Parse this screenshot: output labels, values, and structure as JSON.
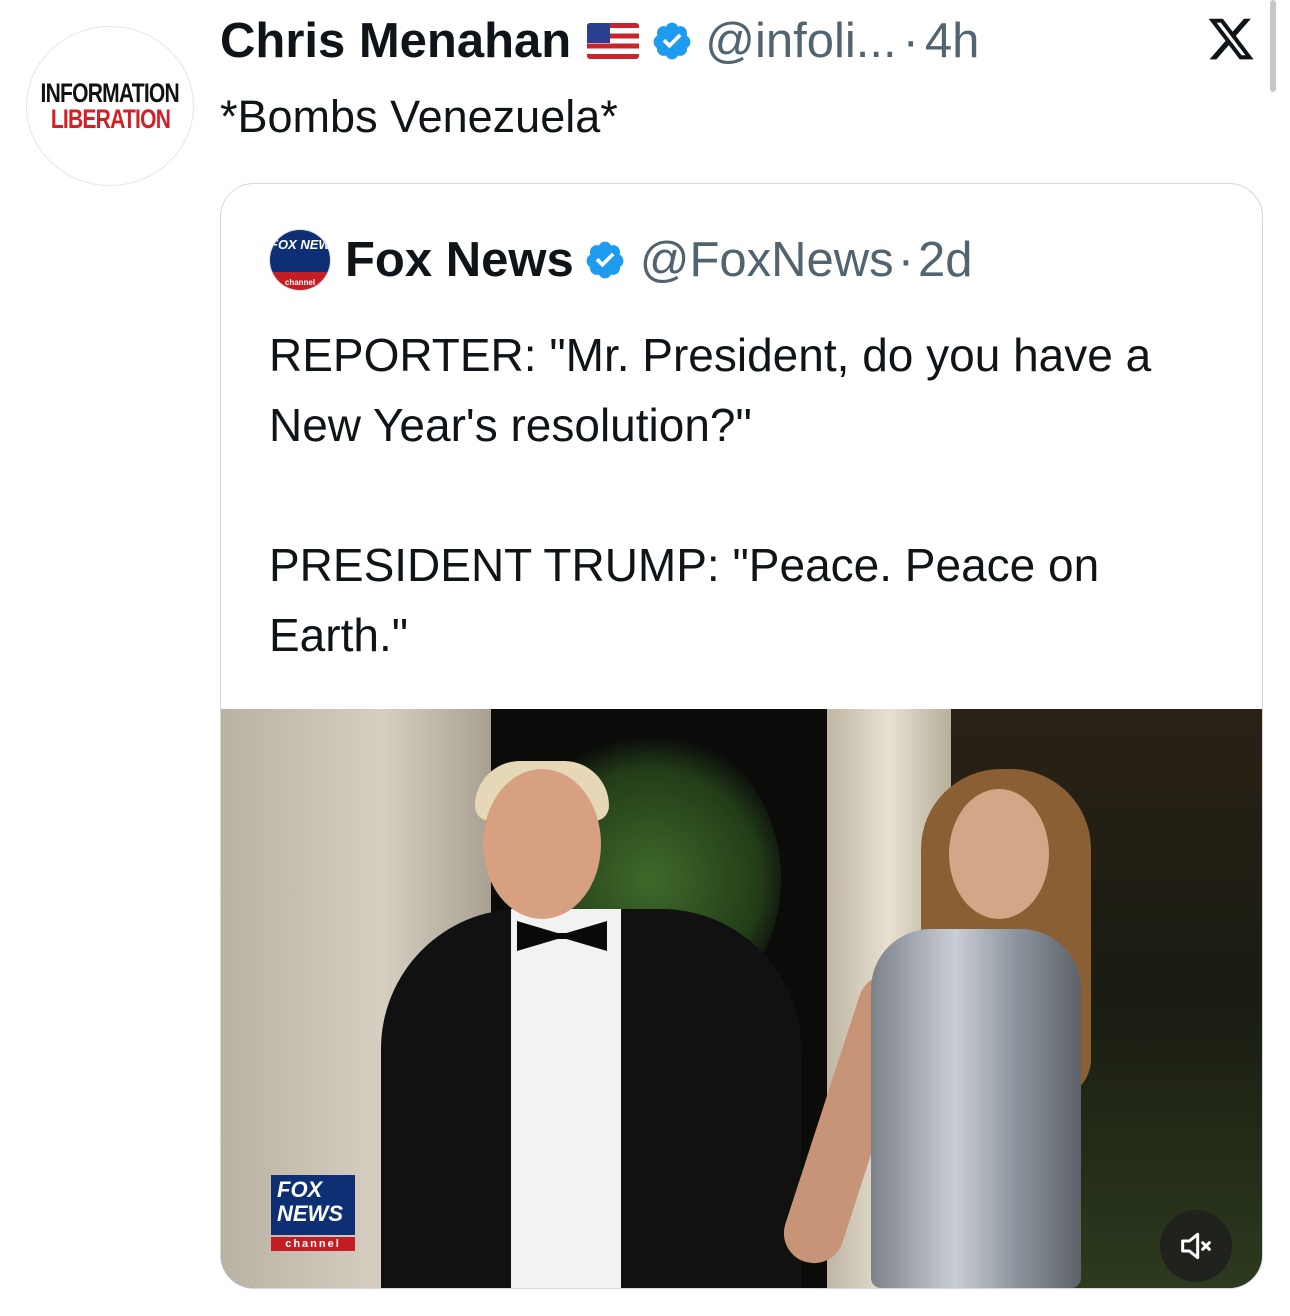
{
  "tweet": {
    "author": {
      "avatar_line1": "INFORMATION",
      "avatar_line2": "LIBERATION",
      "name": "Chris Menahan",
      "flag": "us-flag-icon",
      "verified": true,
      "handle": "@infoli...",
      "time": "4h"
    },
    "text": "*Bombs Venezuela*"
  },
  "quoted_tweet": {
    "author": {
      "avatar_text": "FOX NEWS",
      "avatar_sub": "channel",
      "name": "Fox News",
      "verified": true,
      "handle": "@FoxNews",
      "time": "2d"
    },
    "text": "REPORTER: \"Mr. President, do you have a New Year's resolution?\"\n\nPRESIDENT TRUMP: \"Peace. Peace on Earth.\"",
    "media": {
      "type": "video",
      "watermark_line1": "FOX",
      "watermark_line2": "NEWS",
      "watermark_sub": "channel",
      "muted": true
    }
  },
  "dot": "·",
  "colors": {
    "verified_blue": "#1d9bf0",
    "secondary_text": "#536471",
    "fox_blue": "#0e2f73",
    "fox_red": "#c41e24",
    "brand_red": "#d32027"
  }
}
